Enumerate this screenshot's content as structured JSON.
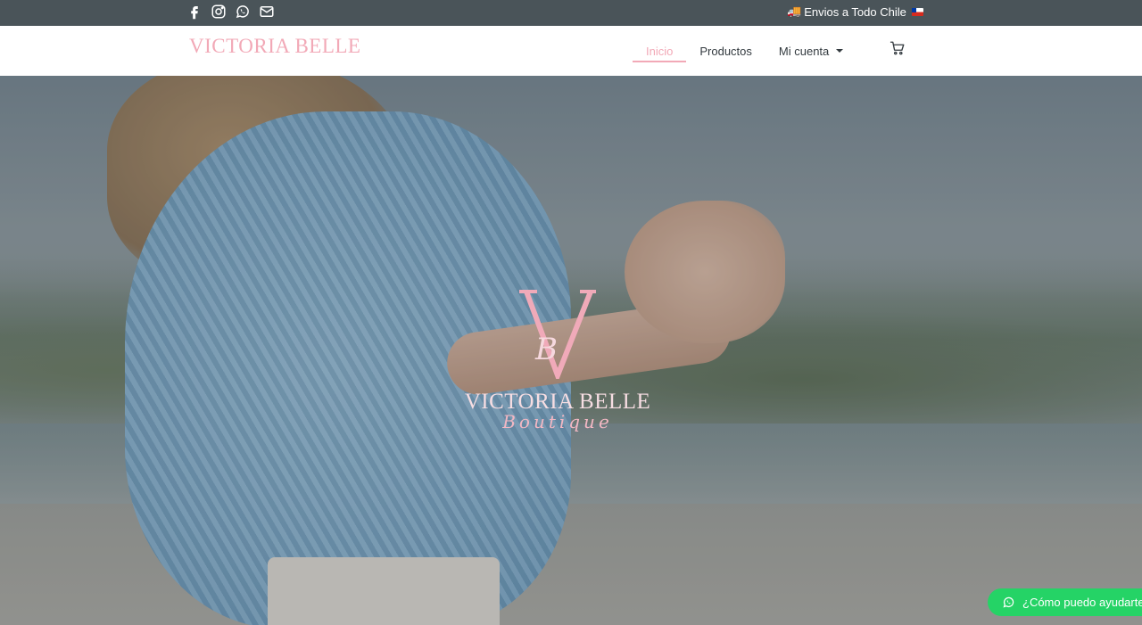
{
  "topbar": {
    "social_icons": [
      "facebook-icon",
      "instagram-icon",
      "whatsapp-icon",
      "envelope-icon"
    ],
    "shipping_emoji": "🚚",
    "shipping_text": "Envios a Todo Chile",
    "flag_icon": "chile-flag-icon"
  },
  "header": {
    "brand": "VICTORIA BELLE",
    "nav": [
      {
        "label": "Inicio",
        "active": true
      },
      {
        "label": "Productos",
        "active": false
      },
      {
        "label": "Mi cuenta",
        "active": false,
        "has_dropdown": true
      }
    ],
    "cart_icon": "shopping-cart-icon"
  },
  "hero": {
    "logo_monogram": "BV",
    "logo_name": "VICTORIA BELLE",
    "logo_subtitle": "Boutique"
  },
  "chat": {
    "icon": "whatsapp-icon",
    "label": "¿Cómo puedo ayudarte?"
  },
  "colors": {
    "topbar_bg": "#4a5459",
    "accent_pink": "#f2a9b7",
    "whatsapp_green": "#25d366"
  }
}
